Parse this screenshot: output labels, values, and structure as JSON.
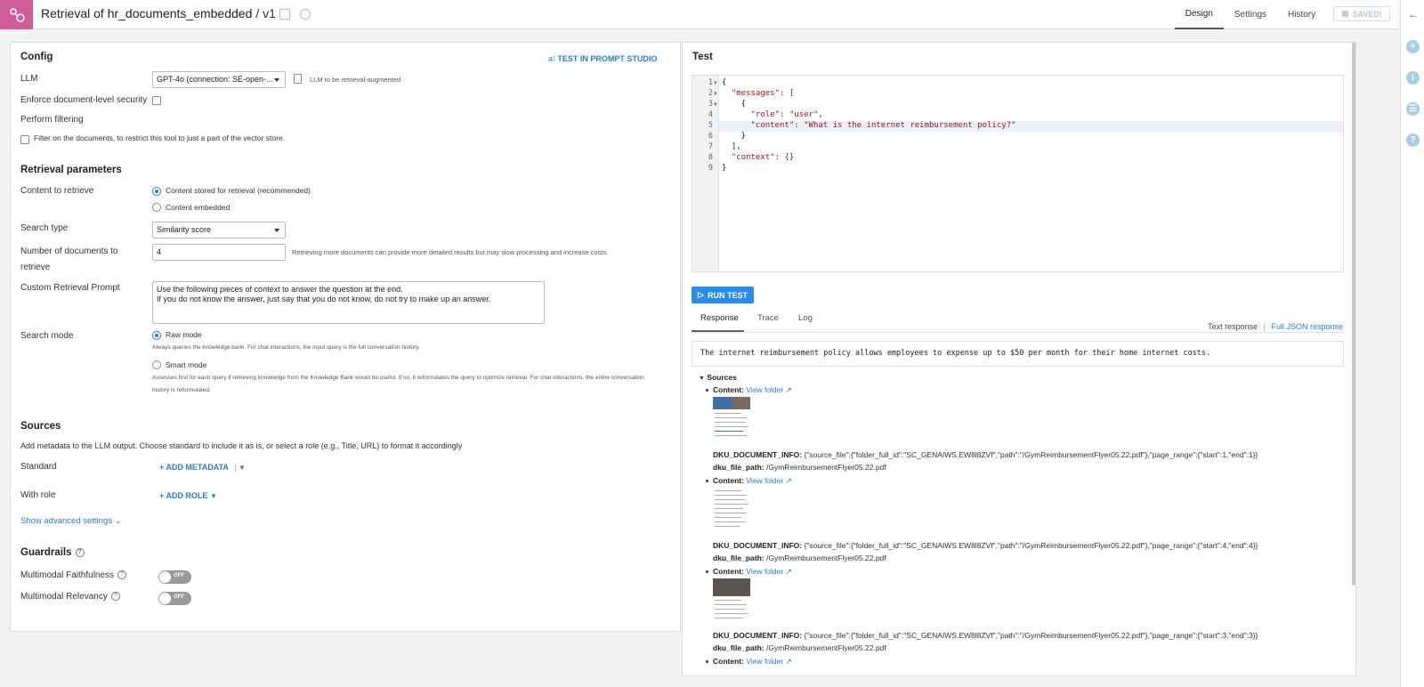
{
  "header": {
    "title": "Retrieval of hr_documents_embedded",
    "version": "/ v1",
    "tabs": [
      "Design",
      "Settings",
      "History"
    ],
    "active_tab": "Design",
    "saved_label": "SAVED!"
  },
  "config": {
    "title": "Config",
    "test_prompt_link": "TEST IN PROMPT STUDIO",
    "llm_label": "LLM",
    "llm_value": "GPT-4o (connection: SE-open-...",
    "llm_hint": "LLM to be retrieval-augmented",
    "enforce_security_label": "Enforce document-level security",
    "perform_filtering_label": "Perform filtering",
    "filter_text": "Filter on the documents, to restrict this tool to just a part of the vector store.",
    "retrieval_title": "Retrieval parameters",
    "content_label": "Content to retrieve",
    "content_options": [
      "Content stored for retrieval (recommended)",
      "Content embedded"
    ],
    "search_type_label": "Search type",
    "search_type_value": "Similarity score",
    "num_docs_label_1": "Number of documents to",
    "num_docs_label_2": "retrieve",
    "num_docs_value": "4",
    "num_docs_hint": "Retrieving more documents can provide more detailed results but may slow processing and increase costs.",
    "custom_prompt_label": "Custom Retrieval Prompt",
    "custom_prompt_line1": "Use the following pieces of context to answer the question at the end.",
    "custom_prompt_line2": "If you do not know the answer, just say that you do not know, do not try to make up an answer.",
    "search_mode_label": "Search mode",
    "raw_mode_label": "Raw mode",
    "raw_mode_desc": "Always queries the knowledge bank. For chat interactions, the input query is the full conversation history.",
    "smart_mode_label": "Smart mode",
    "smart_mode_desc_1": "Assesses first for each query if retrieving knowledge from the Knowledge Bank would be useful. If so, it reformulates the query to optimize retrieval. For chat interactions, the entire conversation",
    "smart_mode_desc_2": "history is reformulated.",
    "sources_title": "Sources",
    "sources_desc": "Add metadata to the LLM output. Choose standard to include it as is, or select a role (e.g., Title, URL) to format it accordingly",
    "standard_label": "Standard",
    "add_metadata": "ADD METADATA",
    "with_role_label": "With role",
    "add_role": "ADD ROLE",
    "advanced": "Show advanced settings",
    "guardrails_title": "Guardrails",
    "faithfulness_label": "Multimodal Faithfulness",
    "relevancy_label": "Multimodal Relevancy",
    "toggle_off": "OFF"
  },
  "test": {
    "title": "Test",
    "code_lines": [
      "{",
      "  \"messages\": [",
      "    {",
      "      \"role\": \"user\",",
      "      \"content\": \"What is the internet reimbursement policy?\"",
      "    }",
      "  ],",
      "  \"context\": {}",
      "}"
    ],
    "run_label": "RUN TEST",
    "tabs": [
      "Response",
      "Trace",
      "Log"
    ],
    "text_response": "Text response",
    "separator": "|",
    "full_json": "Full JSON response",
    "response_text": "The internet reimbursement policy allows employees to expense up to $50 per month for their home internet costs.",
    "sources_label": "Sources",
    "content_label": "Content:",
    "view_folder": "View folder",
    "doc_info_label": "DKU_DOCUMENT_INFO:",
    "file_path_label": "dku_file_path:",
    "sources": [
      {
        "info": "{\"source_file\":{\"folder_full_id\":\"SC_GENAIWS.EW8l8ZVf\",\"path\":\"/GymReimbursementFlyer05.22.pdf\"},\"page_range\":{\"start\":1,\"end\":1}}",
        "path": "/GymReimbursementFlyer05.22.pdf"
      },
      {
        "info": "{\"source_file\":{\"folder_full_id\":\"SC_GENAIWS.EW8l8ZVf\",\"path\":\"/GymReimbursementFlyer05.22.pdf\"},\"page_range\":{\"start\":4,\"end\":4}}",
        "path": "/GymReimbursementFlyer05.22.pdf"
      },
      {
        "info": "{\"source_file\":{\"folder_full_id\":\"SC_GENAIWS.EW8l8ZVf\",\"path\":\"/GymReimbursementFlyer05.22.pdf\"},\"page_range\":{\"start\":3,\"end\":3}}",
        "path": "/GymReimbursementFlyer05.22.pdf"
      }
    ]
  }
}
